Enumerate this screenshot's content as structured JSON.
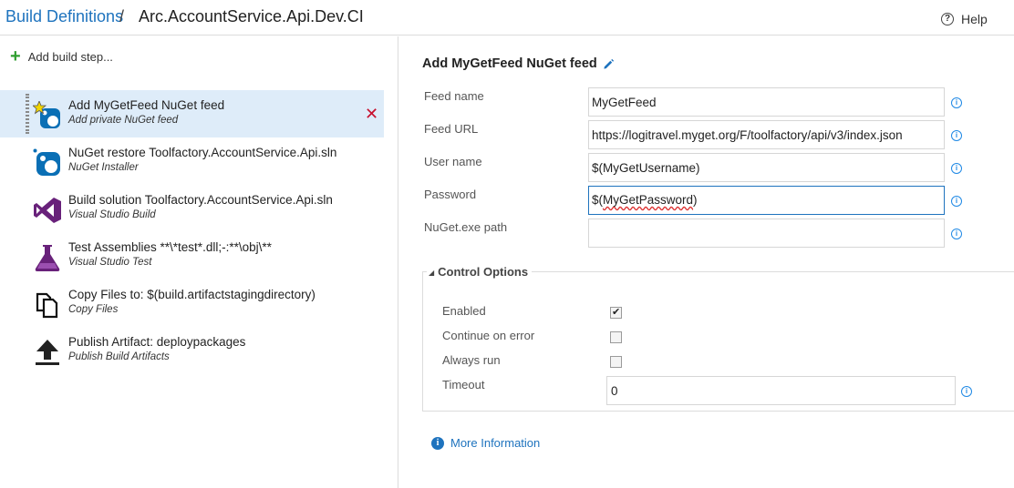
{
  "breadcrumb": {
    "parent": "Build Definitions",
    "separator": "/",
    "current": "Arc.AccountService.Api.Dev.CI"
  },
  "help_label": "Help",
  "add_step_label": "Add build step...",
  "steps": [
    {
      "title": "Add MyGetFeed NuGet feed",
      "subtitle": "Add private NuGet feed",
      "icon": "nuget-star-icon",
      "selected": true
    },
    {
      "title": "NuGet restore Toolfactory.AccountService.Api.sln",
      "subtitle": "NuGet Installer",
      "icon": "nuget-icon",
      "selected": false
    },
    {
      "title": "Build solution Toolfactory.AccountService.Api.sln",
      "subtitle": "Visual Studio Build",
      "icon": "visual-studio-icon",
      "selected": false
    },
    {
      "title": "Test Assemblies **\\*test*.dll;-:**\\obj\\**",
      "subtitle": "Visual Studio Test",
      "icon": "flask-icon",
      "selected": false
    },
    {
      "title": "Copy Files to: $(build.artifactstagingdirectory)",
      "subtitle": "Copy Files",
      "icon": "copy-files-icon",
      "selected": false
    },
    {
      "title": "Publish Artifact: deploypackages",
      "subtitle": "Publish Build Artifacts",
      "icon": "upload-icon",
      "selected": false
    }
  ],
  "task": {
    "title": "Add MyGetFeed NuGet feed",
    "fields": [
      {
        "label": "Feed name",
        "value": "MyGetFeed"
      },
      {
        "label": "Feed URL",
        "value": "https://logitravel.myget.org/F/toolfactory/api/v3/index.json"
      },
      {
        "label": "User name",
        "value": "$(MyGetUsername)"
      },
      {
        "label": "Password",
        "value_prefix": "$(",
        "value_spell": "MyGetPassword",
        "value_suffix": ")"
      },
      {
        "label": "NuGet.exe path",
        "value": ""
      }
    ]
  },
  "control_options": {
    "title": "Control Options",
    "enabled_label": "Enabled",
    "enabled": true,
    "continue_label": "Continue on error",
    "continue": false,
    "always_label": "Always run",
    "always": false,
    "timeout_label": "Timeout",
    "timeout": "0"
  },
  "more_info_label": "More Information",
  "colors": {
    "accent": "#1e73be",
    "selected_bg": "#deecf9",
    "remove": "#c8102e",
    "add": "#2f9e2f"
  }
}
